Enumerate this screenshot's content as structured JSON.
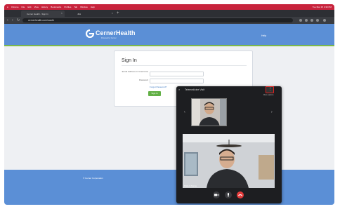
{
  "browser": {
    "menubar": [
      "Chrome",
      "File",
      "Edit",
      "View",
      "History",
      "Bookmarks",
      "Profiles",
      "Tab",
      "Window",
      "Help"
    ],
    "clock": "Tue Mar 15 4:30 PM",
    "tabs": [
      {
        "title": "Cerner Health - Sign In",
        "close": "×"
      },
      {
        "title": "Jitsi",
        "close": "×"
      }
    ],
    "newtab": "+",
    "url": "cernerhealth.com/oauth",
    "nav": {
      "back": "‹",
      "forward": "›",
      "reload": "↻"
    }
  },
  "site": {
    "brand": "CernerHealth",
    "brand_sub": "Powered by Cerner",
    "help": "Help",
    "footer_link": "© Cerner Corporation"
  },
  "signin": {
    "heading": "Sign In",
    "email_label": "Email Address or Username",
    "email_value": "tcernerpt",
    "password_label": "Password",
    "forgot": "Forgot Password?",
    "button": "Sign In"
  },
  "video_call": {
    "title": "Telemedicine Visit",
    "close": "×",
    "menu_icon": "⋮",
    "hint": "More options",
    "participant_name": "Patient Name",
    "arrow_left": "‹",
    "arrow_right": "›",
    "controls": [
      "camera-icon",
      "microphone-icon",
      "hang-up-icon"
    ]
  },
  "colors": {
    "header_blue": "#5b8fd6",
    "accent_green": "#7cb84a",
    "button_green": "#62b046",
    "hangup_red": "#e23b3b",
    "menubar_red": "#c8233c"
  }
}
